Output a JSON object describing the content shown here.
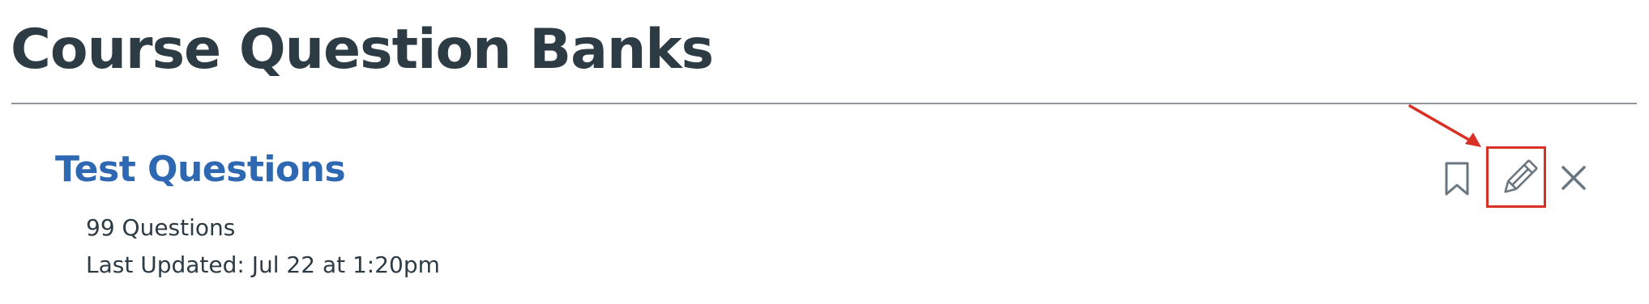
{
  "page": {
    "title": "Course Question Banks"
  },
  "question_bank": {
    "title": "Test Questions",
    "question_count": "99 Questions",
    "last_updated": "Last Updated: Jul 22 at 1:20pm"
  },
  "actions": {
    "bookmark_icon": "bookmark-icon",
    "edit_icon": "pencil-icon",
    "delete_icon": "close-icon"
  },
  "colors": {
    "title_text": "#2d3b45",
    "link_blue": "#2e68b2",
    "icon_gray": "#6b7780",
    "divider": "#8b969e",
    "annotation_red": "#d93025"
  }
}
